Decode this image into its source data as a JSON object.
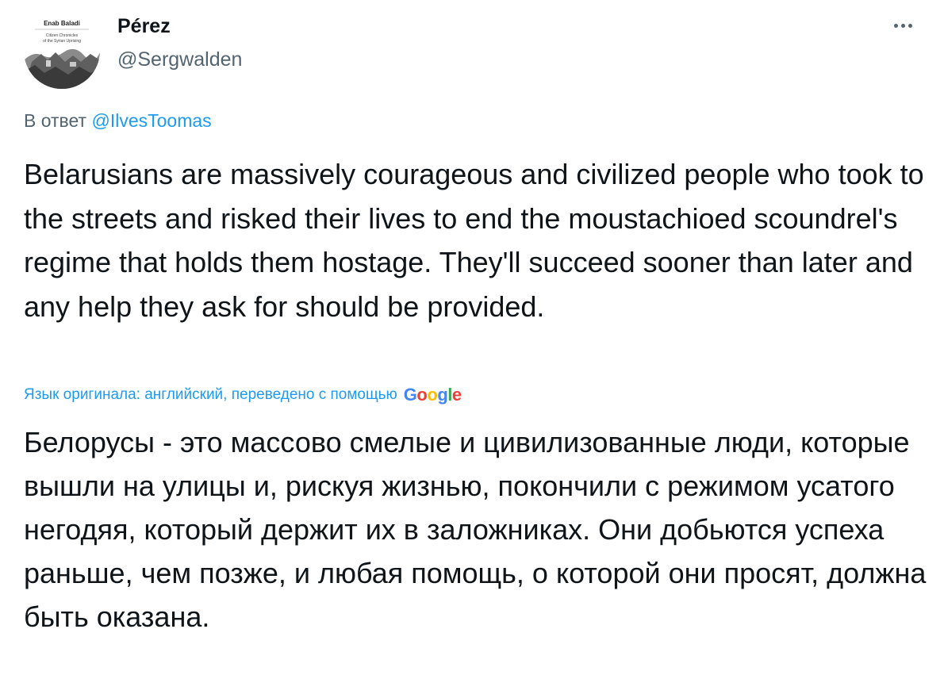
{
  "tweet": {
    "avatar": {
      "title": "Enab Baladi",
      "subtitle_line1": "Citizen Chronicles",
      "subtitle_line2": "of the Syrian Uprising"
    },
    "author": {
      "display_name": "Pérez",
      "handle": "@Sergwalden"
    },
    "more_icon": "more-horizontal-icon",
    "reply_to": {
      "prefix": "В ответ",
      "mention": "@IlvesToomas"
    },
    "text": "Belarusians are massively courageous and civilized people who took to the streets and risked their lives to end the moustachioed scoundrel's regime that holds them hostage. They'll succeed sooner than later and any help they ask for should be provided.",
    "translation": {
      "note": "Язык оригинала: английский, переведено с помощью",
      "provider": "Google",
      "text": "Белорусы - это массово смелые и цивилизованные люди, которые вышли на улицы и, рискуя жизнью, покончили с режимом усатого негодяя, который держит их в заложниках. Они добьются успеха раньше, чем позже, и любая помощь, о которой они просят, должна быть оказана."
    }
  },
  "colors": {
    "text": "#0f1419",
    "secondary": "#536471",
    "link": "#1d9bf0"
  }
}
